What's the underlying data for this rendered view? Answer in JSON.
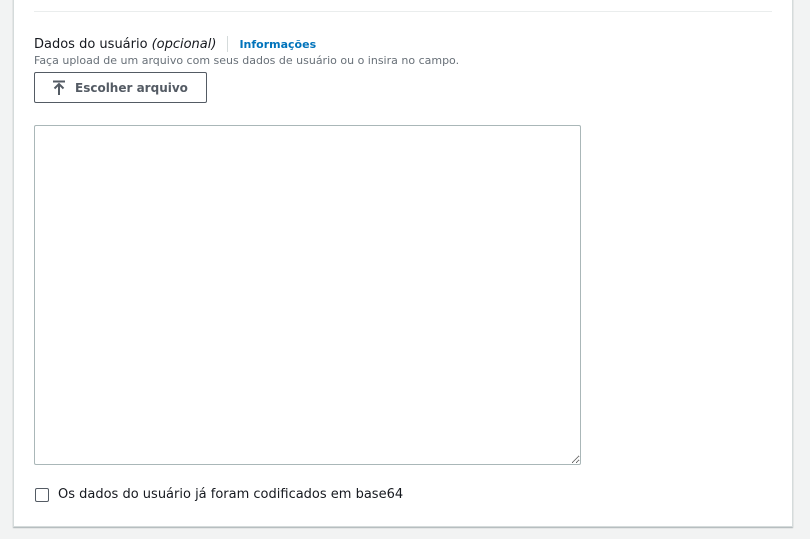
{
  "user_data": {
    "label": "Dados do usuário",
    "optional_tag": "(opcional)",
    "info_link": "Informações",
    "description": "Faça upload de um arquivo com seus dados de usuário ou o insira no campo.",
    "upload_button": {
      "label": "Escolher arquivo",
      "icon": "upload-icon"
    },
    "textarea_value": "",
    "base64_checkbox": {
      "label": "Os dados do usuário já foram codificados em base64",
      "checked": false
    }
  },
  "colors": {
    "link": "#0073bb",
    "text": "#16191f",
    "muted": "#687078",
    "border": "#aab7b8",
    "page_bg": "#f2f3f3"
  }
}
